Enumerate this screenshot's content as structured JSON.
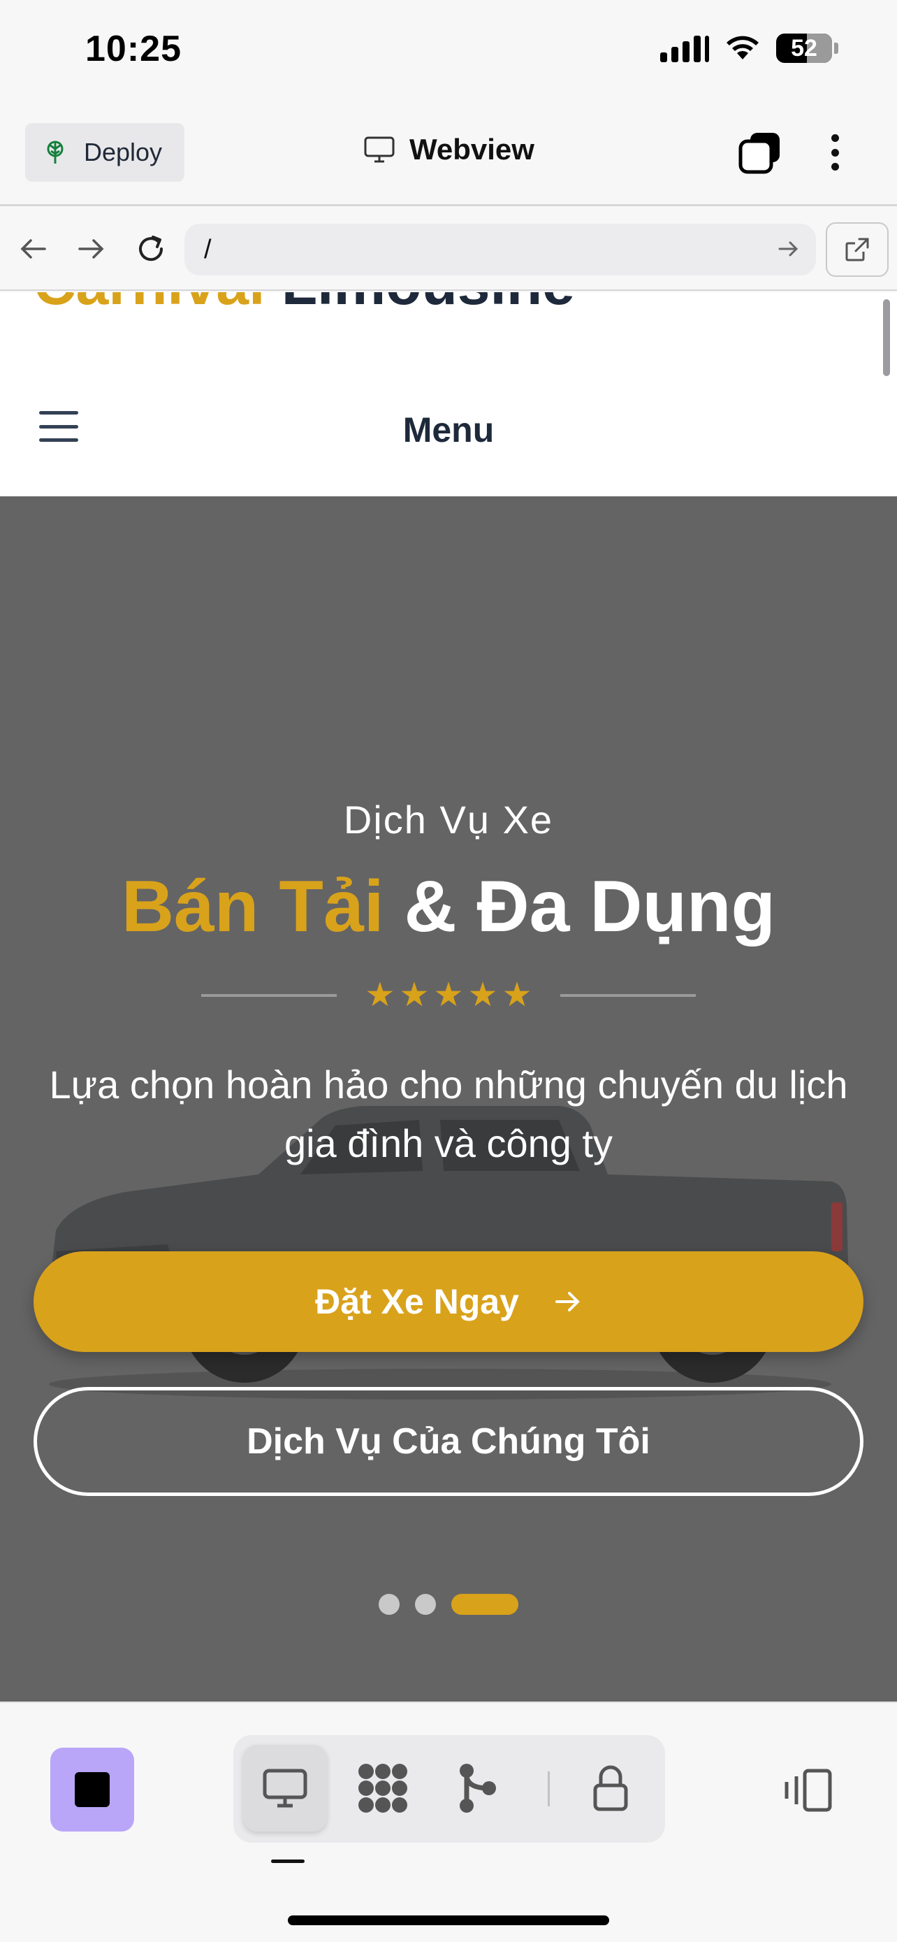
{
  "status_bar": {
    "time": "10:25",
    "battery": "52"
  },
  "app_bar": {
    "deploy_label": "Deploy",
    "title": "Webview"
  },
  "url_bar": {
    "url": "/"
  },
  "site": {
    "brand_part1": "Carnival",
    "brand_part2": "Limousine",
    "menu_label": "Menu",
    "hero": {
      "subtitle": "Dịch Vụ Xe",
      "title_highlight": "Bán Tải",
      "title_rest": "& Đa Dụng",
      "rating_stars": 5,
      "description": "Lựa chọn hoàn hảo cho những chuyến du lịch gia đình và công ty",
      "primary_button": "Đặt Xe Ngay",
      "secondary_button": "Dịch Vụ Của Chúng Tôi",
      "slides_total": 3,
      "active_slide": 3
    }
  },
  "toolbar": {
    "items": [
      "stop",
      "webview",
      "apps",
      "git",
      "lock",
      "layout"
    ],
    "active": "webview"
  },
  "colors": {
    "accent_gold": "#d9a21b",
    "hero_bg": "#646464",
    "text_dark": "#1e293b",
    "stop_button": "#b9a6f8"
  }
}
